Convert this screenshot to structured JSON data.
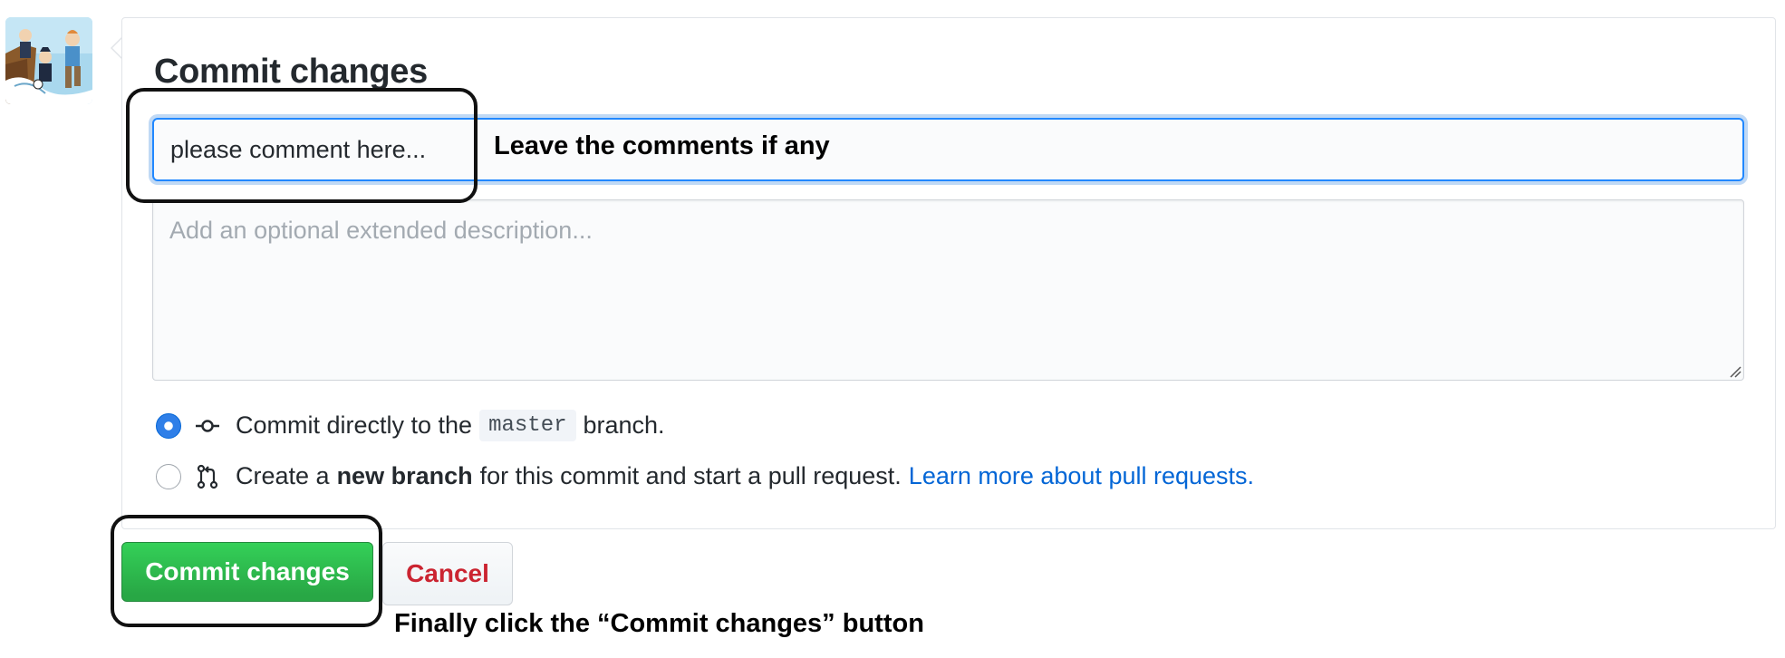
{
  "form": {
    "title": "Commit changes",
    "summary_value": "please comment here...",
    "description_placeholder": "Add an optional extended description..."
  },
  "options": {
    "direct": {
      "prefix": "Commit directly to the",
      "branch": "master",
      "suffix": "branch.",
      "selected": true,
      "icon": "git-commit-icon"
    },
    "new_branch": {
      "prefix": "Create a",
      "bold": "new branch",
      "middle": "for this commit and start a pull request.",
      "link": "Learn more about pull requests.",
      "selected": false,
      "icon": "git-pull-request-icon"
    }
  },
  "buttons": {
    "commit": "Commit changes",
    "cancel": "Cancel"
  },
  "annotations": {
    "comment_hint": "Leave the comments if any",
    "commit_hint": "Finally click the “Commit changes” button"
  },
  "colors": {
    "accent_blue": "#0366d6",
    "commit_green": "#28a745",
    "cancel_red": "#cb2431"
  }
}
